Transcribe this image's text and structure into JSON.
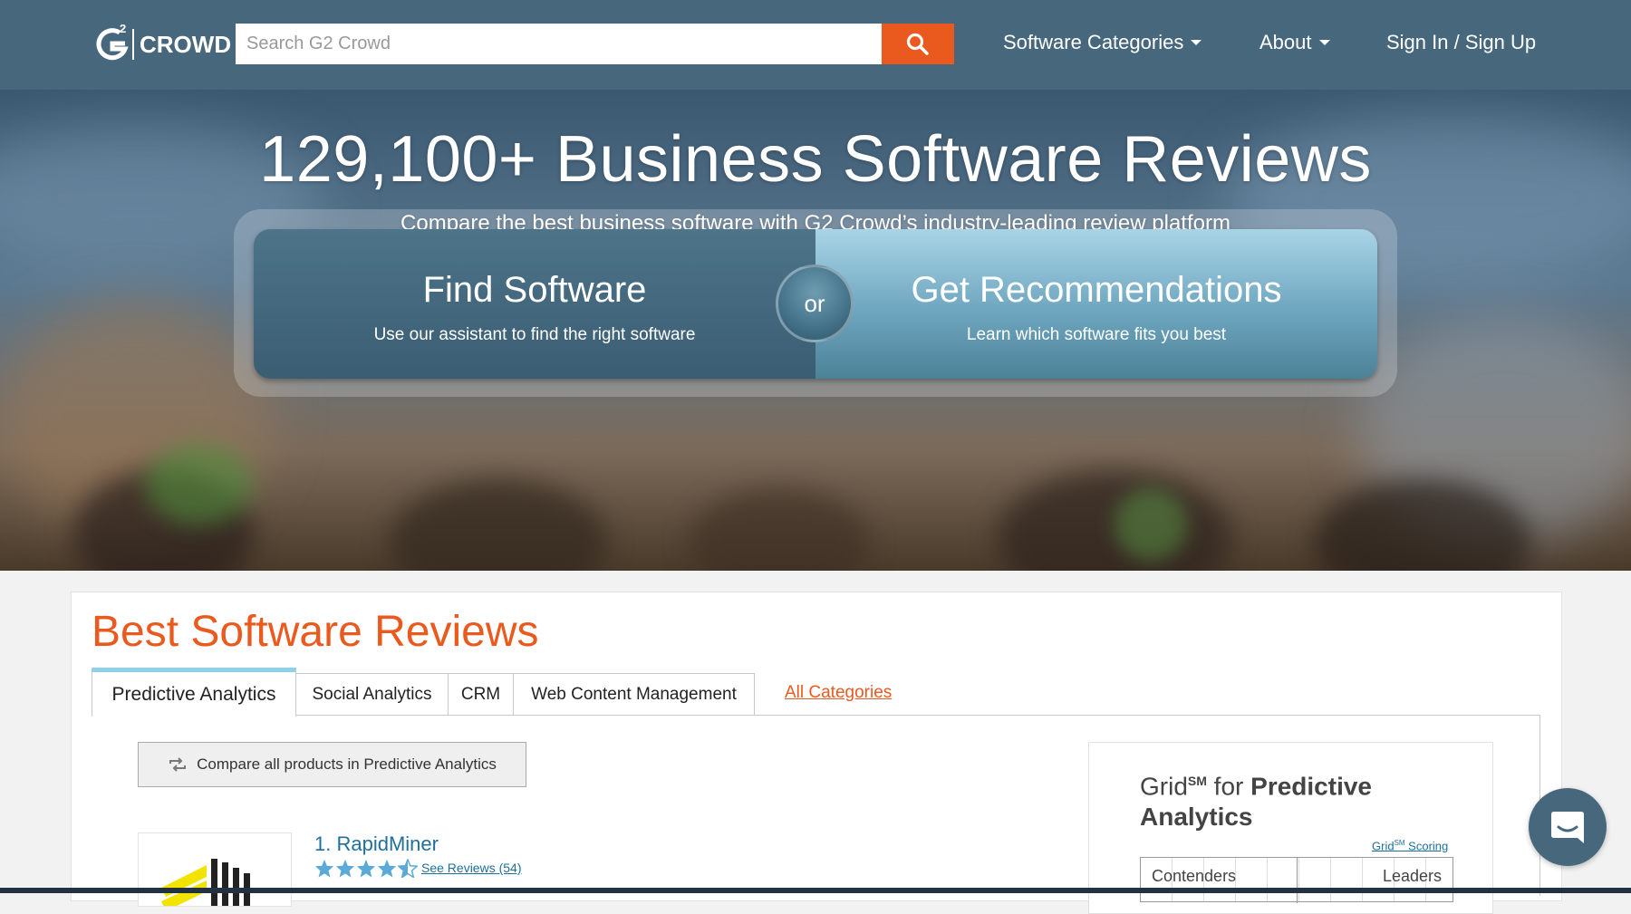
{
  "nav": {
    "logo_text": "CROWD",
    "logo_sup": "2",
    "search_placeholder": "Search G2 Crowd",
    "links": [
      {
        "label": "Software Categories"
      },
      {
        "label": "About"
      },
      {
        "label": "Sign In / Sign Up"
      }
    ]
  },
  "hero": {
    "title": "129,100+ Business Software Reviews",
    "subtitle": "Compare the best business software with G2 Crowd’s industry-leading review platform",
    "find": {
      "title": "Find Software",
      "desc": "Use our assistant to find the right software"
    },
    "or": "or",
    "recommend": {
      "title": "Get Recommendations",
      "desc": "Learn which software fits you best"
    }
  },
  "reviews": {
    "title": "Best Software Reviews",
    "tabs": [
      "Predictive Analytics",
      "Social Analytics",
      "CRM",
      "Web Content Management"
    ],
    "all_categories": "All Categories",
    "compare_label": "Compare all products in Predictive Analytics",
    "product": {
      "name": "1. RapidMiner",
      "rating": 4.5,
      "reviews_link": "See Reviews (54)"
    }
  },
  "grid": {
    "prefix": "Grid",
    "sm": "SM",
    "for": " for ",
    "category": "Predictive Analytics",
    "scoring": "Grid",
    "scoring_sm": "SM",
    "scoring_suffix": " Scoring",
    "left_label": "Contenders",
    "right_label": "Leaders"
  },
  "colors": {
    "nav": "#47687c",
    "accent": "#ea5a1e",
    "link": "#1f6f9c",
    "star": "#5aa9d6"
  },
  "icons": {
    "search": "magnifier-icon",
    "compare": "refresh-arrows-icon",
    "chat": "chat-bubble-icon",
    "star": "star-icon"
  }
}
